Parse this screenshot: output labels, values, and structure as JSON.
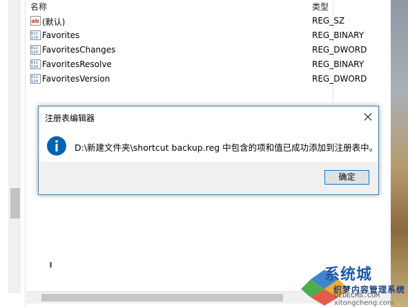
{
  "list": {
    "columns": {
      "name": "名称",
      "type": "类型"
    },
    "rows": [
      {
        "icon": "string-value-icon",
        "name": "(默认)",
        "type": "REG_SZ"
      },
      {
        "icon": "binary-value-icon",
        "name": "Favorites",
        "type": "REG_BINARY"
      },
      {
        "icon": "binary-value-icon",
        "name": "FavoritesChanges",
        "type": "REG_DWORD"
      },
      {
        "icon": "binary-value-icon",
        "name": "FavoritesResolve",
        "type": "REG_BINARY"
      },
      {
        "icon": "binary-value-icon",
        "name": "FavoritesVersion",
        "type": "REG_DWORD"
      }
    ]
  },
  "dialog": {
    "title": "注册表编辑器",
    "icon": "info-icon",
    "message": "D:\\新建文件夹\\shortcut backup.reg 中包含的项和值已成功添加到注册表中。",
    "ok_label": "确定"
  },
  "watermark": {
    "line1": "系统城",
    "line2": "织梦内容管理系统",
    "line3": "DEDECMS.COM",
    "line4": "xitongcheng.com"
  },
  "colors": {
    "dialog_border": "#3c7fb1",
    "button_border": "#0078d7",
    "info_icon": "#0063b1"
  }
}
